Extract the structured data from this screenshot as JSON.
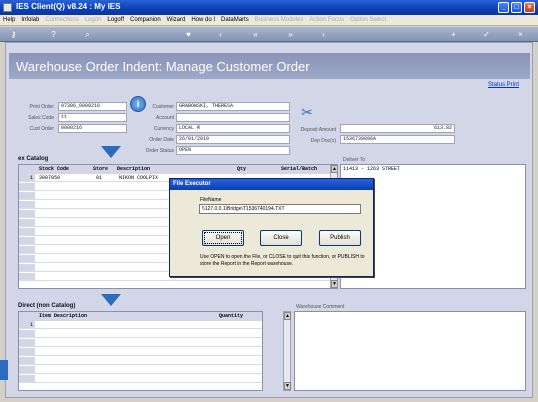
{
  "window": {
    "title": "IES Client(Q) v8.24 : My IES"
  },
  "menu": [
    "Help",
    "Infolab",
    "Connections",
    "Logon",
    "Logoff",
    "Companion",
    "Wizard",
    "How do I",
    "DataMarts",
    "Business Modules",
    "Action Focus",
    "Option Select"
  ],
  "menu_disabled": [
    "Connections",
    "Logon",
    "Business Modules",
    "Action Focus",
    "Option Select"
  ],
  "toolbar": {
    "icons": [
      "key-icon",
      "help-icon",
      "search-icon",
      "favorite-icon",
      "back-icon",
      "forward-icon",
      "rewind-icon",
      "fast-forward-icon",
      "add-icon",
      "confirm-icon",
      "cancel-icon"
    ]
  },
  "header": {
    "title": "Warehouse Order Indent: Manage Customer Order",
    "status_print": "Status Print"
  },
  "fields": {
    "print_order_label": "Print Order",
    "print_order": "07306_0000216",
    "sales_code_label": "Sales Code",
    "sales_code": "tt",
    "cust_order_label": "Cust Order",
    "cust_order": "0000216",
    "customer_label": "Customer",
    "customer": "GRABOWSKI, THERESA",
    "account_label": "Account",
    "account": "",
    "currency_label": "Currency",
    "currency": "LOCAL R",
    "order_date_label": "Order Date",
    "order_date": "26/01/2010",
    "order_status_label": "Order Status",
    "order_status": "OPEN",
    "deposit_amount_label": "Deposit Amount",
    "deposit_amount": "613.82",
    "dep_doc_label": "Dep Doc(s)",
    "dep_doc": "1536739896A"
  },
  "catalog": {
    "title": "ex Catalog",
    "columns": [
      "Stock Code",
      "Store",
      "Description",
      "Qty",
      "Serial/Batch"
    ],
    "rows": [
      {
        "n": "1",
        "stock_code": "3007050",
        "store": "01",
        "description": "NIKON COOLPIX"
      }
    ]
  },
  "deliver_to": {
    "label": "Deliver To",
    "line1": "11413 - 1263 STREET"
  },
  "direct": {
    "title": "Direct (non Catalog)",
    "columns": [
      "Item Description",
      "Quantity"
    ],
    "rows": [
      {
        "n": "1"
      }
    ]
  },
  "warehouse_comment": {
    "label": "Warehouse Comment"
  },
  "dialog": {
    "title": "File Executor",
    "filename_label": "FileName",
    "filename": "\\\\127.0.0.1\\Bridge\\T1536740194.TXT",
    "open": "Open",
    "close": "Close",
    "publish": "Publish",
    "message": "Use OPEN to open the File, or CLOSE to quit this function, or PUBLISH to store the Report in the Report warehouse."
  },
  "colors": {
    "title_bar": "#0b3fb4",
    "header": "#9ea8c8",
    "pane": "#d2d6e6",
    "accent": "#2b6cc0"
  }
}
